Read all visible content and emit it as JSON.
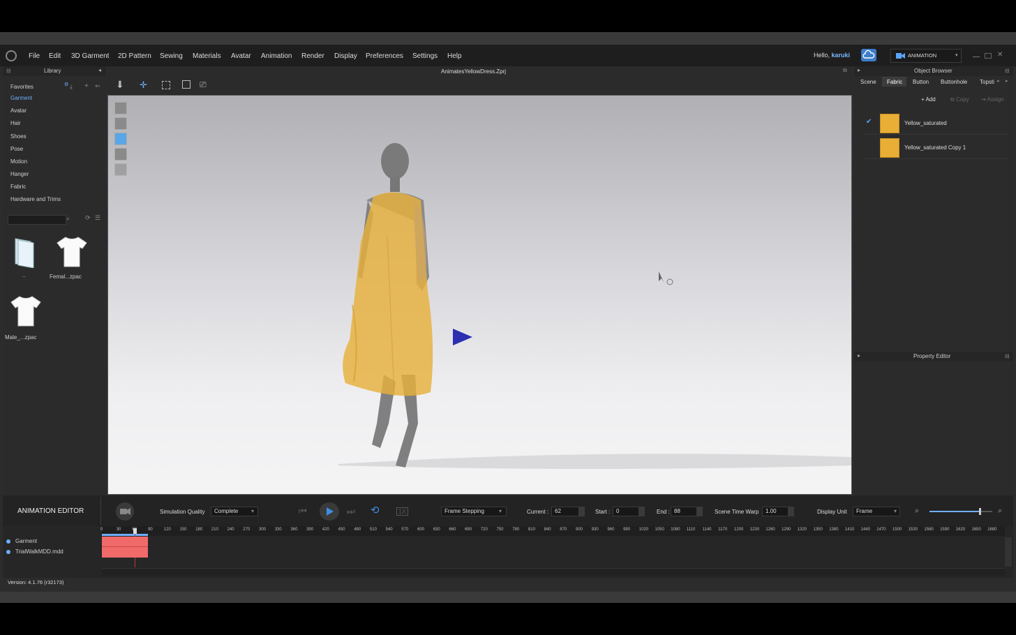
{
  "menubar": {
    "items": [
      "File",
      "Edit",
      "3D Garment",
      "2D Pattern",
      "Sewing",
      "Materials",
      "Avatar",
      "Animation",
      "Render",
      "Display",
      "Preferences",
      "Settings",
      "Help"
    ],
    "greeting": "Hello,",
    "username": "karuki",
    "mode_label": "ANIMATION"
  },
  "library": {
    "title": "Library",
    "favorites": "Favorites",
    "categories": [
      "Garment",
      "Avatar",
      "Hair",
      "Shoes",
      "Pose",
      "Motion",
      "Hanger",
      "Fabric",
      "Hardware and Trims"
    ],
    "active_category": "Garment",
    "thumbnails": [
      "..",
      "Femal...zpac",
      "Male_...zpac"
    ]
  },
  "viewport": {
    "file_title": "AnimatesYellowDress.Zprj"
  },
  "object_browser": {
    "title": "Object Browser",
    "tabs": [
      "Scene",
      "Fabric",
      "Button",
      "Buttonhole",
      "Topsti"
    ],
    "selected_tab": "Fabric",
    "actions": [
      "Add",
      "Copy",
      "Assign"
    ],
    "fabrics": [
      {
        "name": "Yellow_saturated",
        "checked": true,
        "color": "#e9ae36"
      },
      {
        "name": "Yellow_saturated Copy 1",
        "checked": false,
        "color": "#e9ae36"
      }
    ]
  },
  "property_editor": {
    "title": "Property Editor"
  },
  "animation_editor": {
    "title": "ANIMATION EDITOR",
    "simulation_quality_label": "Simulation Quality",
    "simulation_quality_value": "Complete",
    "speed_label": "1X",
    "frame_mode": "Frame Stepping",
    "current_label": "Current :",
    "current_value": "62",
    "start_label": "Start :",
    "start_value": "0",
    "end_label": "End :",
    "end_value": "88",
    "time_warp_label": "Scene Time Warp",
    "time_warp_value": "1.00",
    "display_unit_label": "Display Unit",
    "display_unit_value": "Frame",
    "zoom_fraction": 0.8,
    "ruler_ticks": [
      "0",
      "30",
      "60",
      "90",
      "120",
      "150",
      "180",
      "210",
      "240",
      "270",
      "300",
      "330",
      "360",
      "390",
      "420",
      "450",
      "480",
      "510",
      "540",
      "570",
      "600",
      "630",
      "660",
      "690",
      "720",
      "750",
      "780",
      "810",
      "840",
      "870",
      "900",
      "930",
      "960",
      "990",
      "1020",
      "1050",
      "1080",
      "1110",
      "1140",
      "1170",
      "1200",
      "1230",
      "1260",
      "1290",
      "1320",
      "1350",
      "1380",
      "1410",
      "1440",
      "1470",
      "1500",
      "1530",
      "1560",
      "1590",
      "1620",
      "1650",
      "1680"
    ],
    "tracks": [
      "Garment",
      "TrialWalkMDD.mdd"
    ],
    "version": "Version: 4.1.76 (r32173)"
  },
  "colors": {
    "accent": "#6eb0ff",
    "fabric_yellow": "#e9ae36",
    "timeline_clip": "#f06a6a",
    "play_button": "#3d8ee0"
  }
}
